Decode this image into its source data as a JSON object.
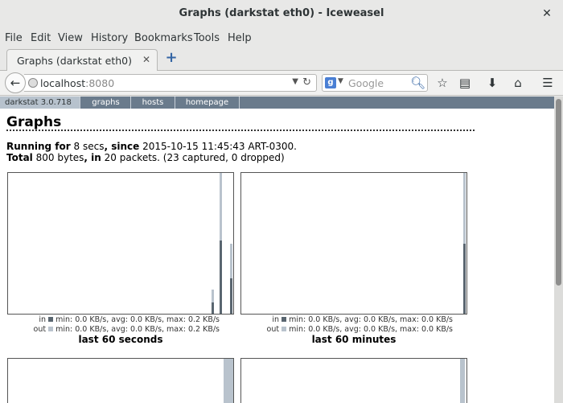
{
  "window": {
    "title": "Graphs (darkstat eth0) - Iceweasel"
  },
  "menu": [
    "File",
    "Edit",
    "View",
    "History",
    "Bookmarks",
    "Tools",
    "Help"
  ],
  "tab": {
    "label": "Graphs (darkstat eth0)"
  },
  "url": {
    "host": "localhost",
    "port": ":8080"
  },
  "search": {
    "placeholder": "Google",
    "engine_letter": "g"
  },
  "darkstat": {
    "nav": [
      "darkstat 3.0.718",
      "graphs",
      "hosts",
      "homepage"
    ],
    "heading": "Graphs",
    "running": {
      "label": "Running for",
      "secs": "8 secs",
      "since_label": ", since",
      "since": "2015-10-15 11:45:43 ART-0300."
    },
    "total": {
      "label": "Total",
      "bytes": "800 bytes",
      "in_label": ", in",
      "packets": "20 packets.",
      "captured": "(23 captured, 0 dropped)"
    }
  },
  "colors": {
    "in": "#5a6670",
    "out": "#b9c3cd",
    "nav_bg": "#6a7b8c"
  },
  "graphs": [
    {
      "title": "last 60 seconds",
      "in_line": "in",
      "in_stats": "min: 0.0 KB/s, avg: 0.0 KB/s, max: 0.2 KB/s",
      "out_line": "out",
      "out_stats": "min: 0.0 KB/s, avg: 0.0 KB/s, max: 0.2 KB/s"
    },
    {
      "title": "last 60 minutes",
      "in_line": "in",
      "in_stats": "min: 0.0 KB/s, avg: 0.0 KB/s, max: 0.0 KB/s",
      "out_line": "out",
      "out_stats": "min: 0.0 KB/s, avg: 0.0 KB/s, max: 0.0 KB/s"
    }
  ]
}
